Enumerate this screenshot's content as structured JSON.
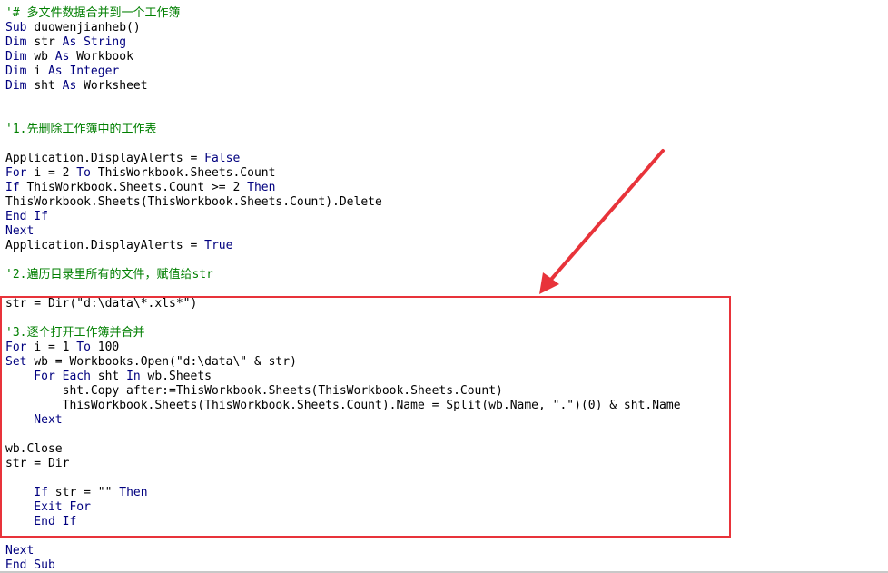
{
  "colors": {
    "keyword": "#00007f",
    "comment": "#007f00",
    "text": "#000000",
    "highlight_border": "#e8333a",
    "arrow": "#e8333a"
  },
  "code_lines": [
    [
      {
        "t": "'# 多文件数据合并到一个工作簿",
        "k": "cm"
      }
    ],
    [
      {
        "t": "Sub ",
        "k": "kw"
      },
      {
        "t": "duowenjianheb()",
        "k": "tx"
      }
    ],
    [
      {
        "t": "Dim ",
        "k": "kw"
      },
      {
        "t": "str ",
        "k": "tx"
      },
      {
        "t": "As String",
        "k": "kw"
      }
    ],
    [
      {
        "t": "Dim ",
        "k": "kw"
      },
      {
        "t": "wb ",
        "k": "tx"
      },
      {
        "t": "As ",
        "k": "kw"
      },
      {
        "t": "Workbook",
        "k": "tx"
      }
    ],
    [
      {
        "t": "Dim ",
        "k": "kw"
      },
      {
        "t": "i ",
        "k": "tx"
      },
      {
        "t": "As Integer",
        "k": "kw"
      }
    ],
    [
      {
        "t": "Dim ",
        "k": "kw"
      },
      {
        "t": "sht ",
        "k": "tx"
      },
      {
        "t": "As ",
        "k": "kw"
      },
      {
        "t": "Worksheet",
        "k": "tx"
      }
    ],
    [],
    [],
    [
      {
        "t": "'1.先删除工作簿中的工作表",
        "k": "cm"
      }
    ],
    [],
    [
      {
        "t": "Application.DisplayAlerts = ",
        "k": "tx"
      },
      {
        "t": "False",
        "k": "kw"
      }
    ],
    [
      {
        "t": "For ",
        "k": "kw"
      },
      {
        "t": "i = 2 ",
        "k": "tx"
      },
      {
        "t": "To ",
        "k": "kw"
      },
      {
        "t": "ThisWorkbook.Sheets.Count",
        "k": "tx"
      }
    ],
    [
      {
        "t": "If ",
        "k": "kw"
      },
      {
        "t": "ThisWorkbook.Sheets.Count >= 2 ",
        "k": "tx"
      },
      {
        "t": "Then",
        "k": "kw"
      }
    ],
    [
      {
        "t": "ThisWorkbook.Sheets(ThisWorkbook.Sheets.Count).Delete",
        "k": "tx"
      }
    ],
    [
      {
        "t": "End If",
        "k": "kw"
      }
    ],
    [
      {
        "t": "Next",
        "k": "kw"
      }
    ],
    [
      {
        "t": "Application.DisplayAlerts = ",
        "k": "tx"
      },
      {
        "t": "True",
        "k": "kw"
      }
    ],
    [],
    [
      {
        "t": "'2.遍历目录里所有的文件，赋值给str",
        "k": "cm"
      }
    ],
    [],
    [
      {
        "t": "str = Dir(\"d:\\data\\*.xls*\")",
        "k": "tx"
      }
    ],
    [],
    [
      {
        "t": "'3.逐个打开工作簿并合并",
        "k": "cm"
      }
    ],
    [
      {
        "t": "For ",
        "k": "kw"
      },
      {
        "t": "i = 1 ",
        "k": "tx"
      },
      {
        "t": "To ",
        "k": "kw"
      },
      {
        "t": "100",
        "k": "tx"
      }
    ],
    [
      {
        "t": "Set ",
        "k": "kw"
      },
      {
        "t": "wb = Workbooks.Open(\"d:\\data\\\" & str)",
        "k": "tx"
      }
    ],
    [
      {
        "t": "    For Each ",
        "k": "kw"
      },
      {
        "t": "sht ",
        "k": "tx"
      },
      {
        "t": "In ",
        "k": "kw"
      },
      {
        "t": "wb.Sheets",
        "k": "tx"
      }
    ],
    [
      {
        "t": "        sht.Copy after:=ThisWorkbook.Sheets(ThisWorkbook.Sheets.Count)",
        "k": "tx"
      }
    ],
    [
      {
        "t": "        ThisWorkbook.Sheets(ThisWorkbook.Sheets.Count).Name = Split(wb.Name, \".\")(0) & sht.Name",
        "k": "tx"
      }
    ],
    [
      {
        "t": "    Next",
        "k": "kw"
      }
    ],
    [],
    [
      {
        "t": "wb.Close",
        "k": "tx"
      }
    ],
    [
      {
        "t": "str = Dir",
        "k": "tx"
      }
    ],
    [],
    [
      {
        "t": "    If ",
        "k": "kw"
      },
      {
        "t": "str = \"\" ",
        "k": "tx"
      },
      {
        "t": "Then",
        "k": "kw"
      }
    ],
    [
      {
        "t": "    Exit For",
        "k": "kw"
      }
    ],
    [
      {
        "t": "    End If",
        "k": "kw"
      }
    ],
    [],
    [
      {
        "t": "Next",
        "k": "kw"
      }
    ],
    [
      {
        "t": "End Sub",
        "k": "kw"
      }
    ]
  ]
}
